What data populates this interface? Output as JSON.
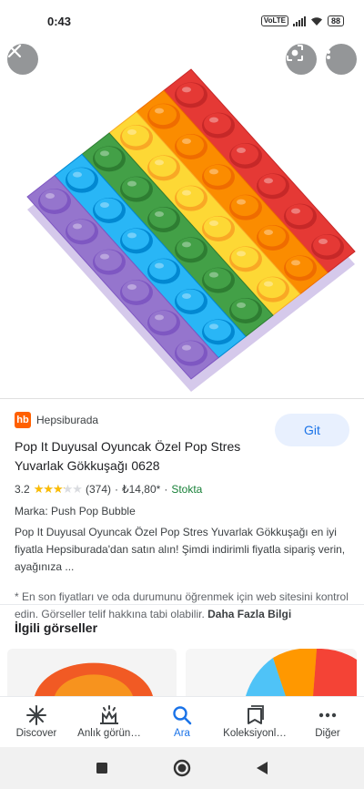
{
  "status_bar": {
    "time": "0:43",
    "battery": "88",
    "signal_box": "VoLTE"
  },
  "colors": {
    "accent": "#1a73e8",
    "brand": "#ff6000",
    "stock": "#188038",
    "star": "#fbbc04"
  },
  "viewer": {
    "icons": {
      "close": "close-icon",
      "lens": "lens-icon",
      "more": "more-vert-icon"
    }
  },
  "result": {
    "source_logo": "hb",
    "source": "Hepsiburada",
    "go_button": "Git",
    "title": "Pop It Duyusal Oyuncak Özel Pop Stres Yuvarlak Gökkuşağı 0628",
    "rating": "3.2",
    "rating_value": 3.2,
    "rating_max": 5,
    "reviews": "(374)",
    "separator": "·",
    "price": "₺14,80*",
    "availability": "Stokta",
    "brand": "Marka: Push Pop Bubble",
    "description": "Pop It Duyusal Oyuncak Özel Pop Stres Yuvarlak Gökkuşağı en iyi fiyatla Hepsiburada'dan satın alın! Şimdi indirimli fiyatla sipariş verin, ayağınıza ...",
    "disclaimer": "* En son fiyatları ve oda durumunu öğrenmek için web sitesini kontrol edin. Görseller telif hakkına tabi olabilir.",
    "more_info": "Daha Fazla Bilgi"
  },
  "related": {
    "title": "İlgili görseller"
  },
  "bottom_nav": [
    {
      "label": "Discover",
      "icon": "discover-icon",
      "active": false
    },
    {
      "label": "Anlık görün…",
      "icon": "updates-icon",
      "active": false
    },
    {
      "label": "Ara",
      "icon": "search-icon",
      "active": true
    },
    {
      "label": "Koleksiyonl…",
      "icon": "collections-icon",
      "active": false
    },
    {
      "label": "Diğer",
      "icon": "more-horiz-icon",
      "active": false
    }
  ],
  "system_nav": {
    "icons": [
      "recents-icon",
      "home-icon",
      "back-icon"
    ]
  }
}
